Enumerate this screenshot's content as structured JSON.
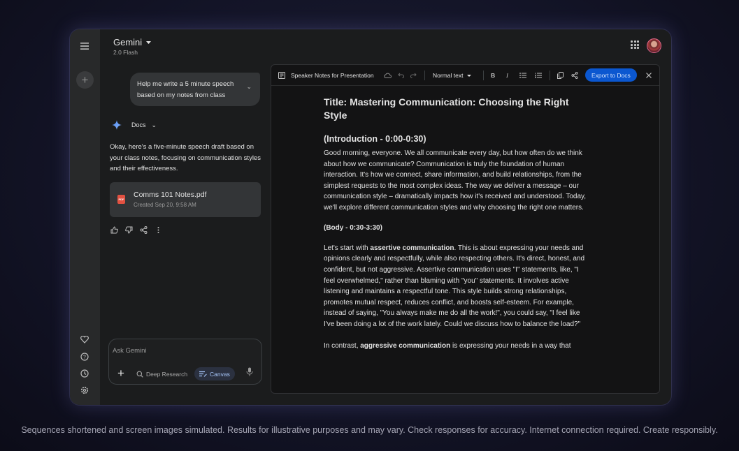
{
  "app": {
    "title": "Gemini",
    "model": "2.0 Flash"
  },
  "chat": {
    "user_message": "Help me write a 5 minute speech based on my notes from class",
    "tool_label": "Docs",
    "response": "Okay, here's a five-minute speech draft based on your class notes, focusing on communication styles and their effectiveness.",
    "attachment": {
      "name": "Comms 101 Notes.pdf",
      "created": "Created Sep 20, 9:58 AM",
      "icon_text": "PDF"
    }
  },
  "input": {
    "placeholder": "Ask Gemini",
    "deep_research": "Deep Research",
    "canvas": "Canvas"
  },
  "canvas": {
    "doc_title": "Speaker Notes for Presentation",
    "text_style": "Normal text",
    "export_label": "Export to Docs",
    "bold_label": "B",
    "italic_label": "I",
    "content": {
      "title": "Title: Mastering Communication: Choosing the Right Style",
      "intro_heading": "(Introduction - 0:00-0:30)",
      "intro_text": "Good morning, everyone. We all communicate every day, but how often do we think about how we communicate? Communication is truly the foundation of human interaction. It's how we connect, share information, and build relationships, from the simplest requests to the most complex ideas. The way we deliver a message – our communication style – dramatically impacts how it's received and understood. Today, we'll explore different communication styles and why choosing the right one matters.",
      "body_heading": "(Body - 0:30-3:30)",
      "assertive_pre": "Let's start with ",
      "assertive_bold": "assertive communication",
      "assertive_text": ". This is about expressing your needs and opinions clearly and respectfully, while also respecting others. It's direct, honest, and confident, but not aggressive. Assertive communication uses \"I\" statements, like, \"I feel overwhelmed,\" rather than blaming with \"you\" statements. It involves active listening and maintains a respectful tone. This style builds strong relationships, promotes mutual respect, reduces conflict, and boosts self-esteem. For example, instead of saying, \"You always make me do all the work!\", you could say, \"I feel like I've been doing a lot of the work lately. Could we discuss how to balance the load?\"",
      "aggressive_pre": "In contrast, ",
      "aggressive_bold": "aggressive communication",
      "aggressive_text": " is expressing your needs in a way that"
    }
  },
  "disclaimer": "Sequences shortened and screen images simulated. Results for illustrative purposes and may vary. Check responses for accuracy. Internet connection required. Create responsibly.",
  "colors": {
    "accent": "#0b57d0",
    "canvas_chip": "#a8c7fa",
    "pdf": "#e25141"
  }
}
